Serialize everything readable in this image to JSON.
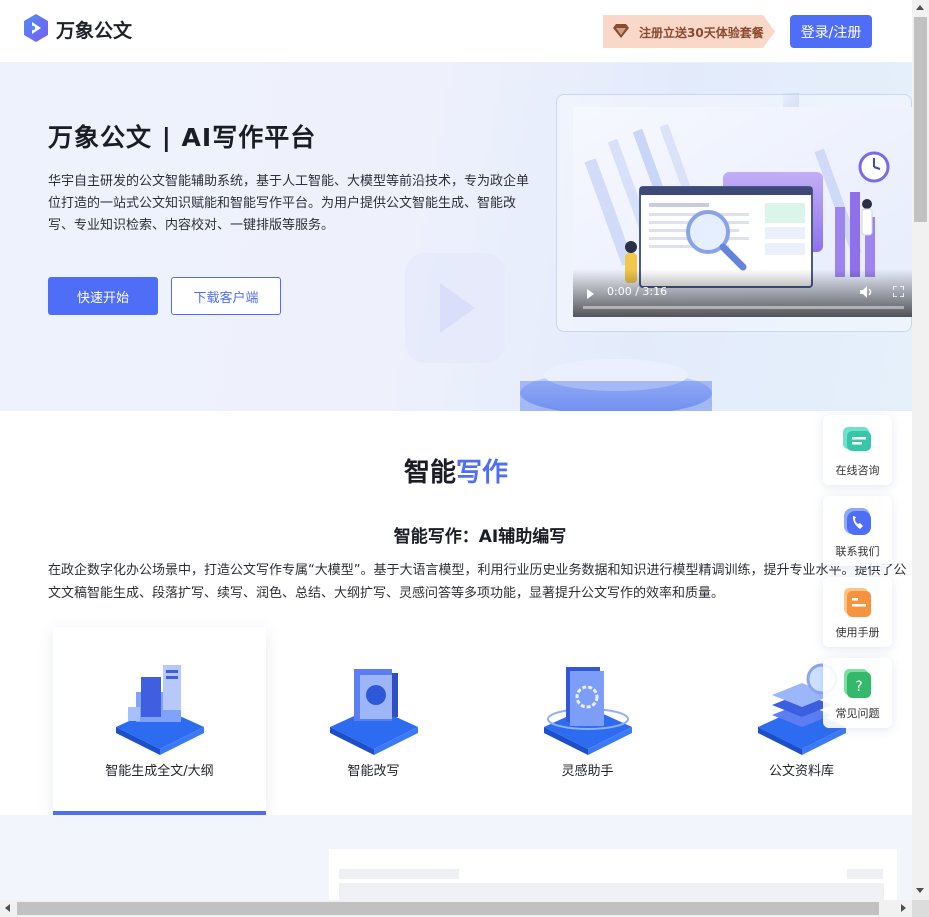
{
  "header": {
    "brand": "万象公文",
    "promo": "注册立送30天体验套餐",
    "login_label": "登录/注册"
  },
  "hero": {
    "title": "万象公文 | AI写作平台",
    "description": "华宇自主研发的公文智能辅助系统，基于人工智能、大模型等前沿技术，专为政企单位打造的一站式公文知识赋能和智能写作平台。为用户提供公文智能生成、智能改写、专业知识检索、内容校对、一键排版等服务。",
    "start_label": "快速开始",
    "download_label": "下载客户端",
    "video": {
      "time": "0:00 / 3:16"
    }
  },
  "writing": {
    "title_part1": "智能",
    "title_part2": "写作",
    "subtitle": "智能写作：AI辅助编写",
    "description": "在政企数字化办公场景中，打造公文写作专属“大模型”。基于大语言模型，利用行业历史业务数据和知识进行模型精调训练，提升专业水平。提供了公文文稿智能生成、段落扩写、续写、润色、总结、大纲扩写、灵感问答等多项功能，显著提升公文写作的效率和质量。",
    "features": [
      {
        "label": "智能生成全文/大纲",
        "icon": "document-generate-icon",
        "active": true
      },
      {
        "label": "智能改写",
        "icon": "rewrite-icon",
        "active": false
      },
      {
        "label": "灵感助手",
        "icon": "inspiration-icon",
        "active": false
      },
      {
        "label": "公文资料库",
        "icon": "library-icon",
        "active": false
      }
    ]
  },
  "sidebar": {
    "items": [
      {
        "label": "在线咨询",
        "icon": "chat-icon"
      },
      {
        "label": "联系我们",
        "icon": "phone-icon"
      },
      {
        "label": "使用手册",
        "icon": "manual-icon"
      },
      {
        "label": "常见问题",
        "icon": "faq-icon"
      }
    ]
  },
  "colors": {
    "accent": "#4f6ef7",
    "promo_bg": "#f9d3c3",
    "hero_bg": "#eef2fd"
  }
}
